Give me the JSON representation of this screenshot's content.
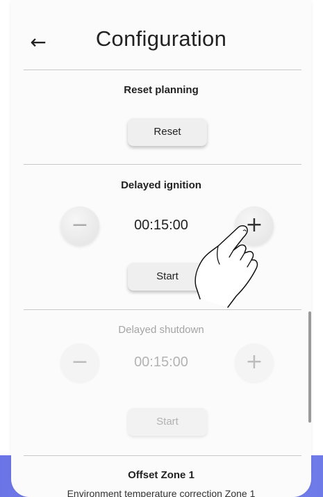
{
  "header": {
    "title": "Configuration",
    "back_icon": "arrow-left-icon"
  },
  "reset_planning": {
    "title": "Reset planning",
    "button_label": "Reset"
  },
  "delayed_ignition": {
    "title": "Delayed ignition",
    "value": "00:15:00",
    "minus_label": "−",
    "plus_label": "+",
    "button_label": "Start"
  },
  "delayed_shutdown": {
    "title": "Delayed shutdown",
    "value": "00:15:00",
    "minus_label": "−",
    "plus_label": "+",
    "button_label": "Start",
    "disabled": true
  },
  "offset_zone_1": {
    "title": "Offset Zone 1",
    "description": "Environment temperature correction Zone 1"
  },
  "overlay": {
    "icon": "hand-pointer-icon"
  },
  "colors": {
    "accent_background": "#7b82ec",
    "text": "#222222",
    "disabled_text": "#a4a4a4"
  }
}
